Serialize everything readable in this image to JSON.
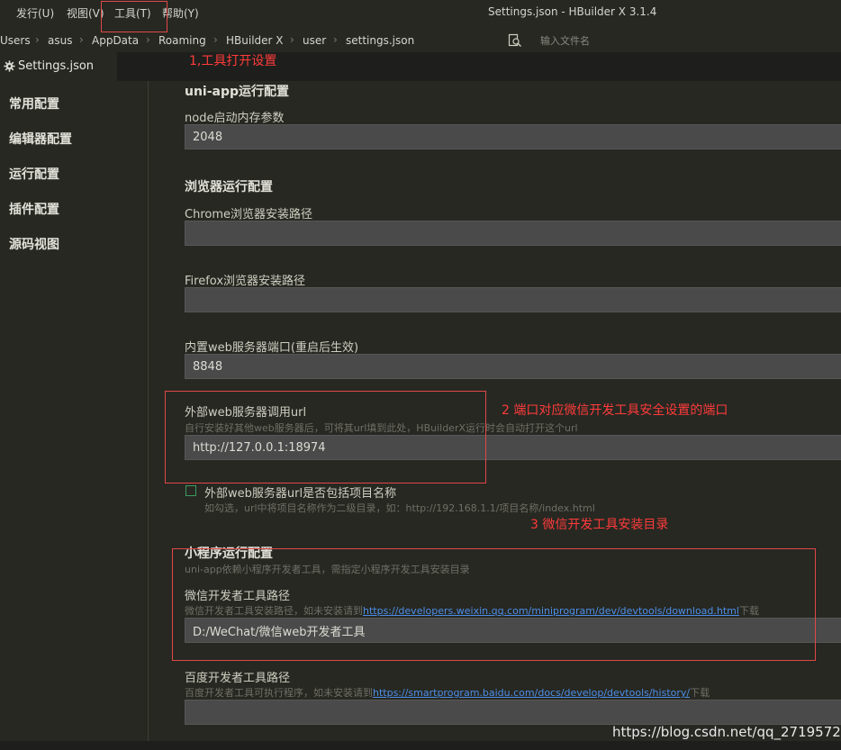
{
  "menu": {
    "items": [
      "发行(U)",
      "视图(V)",
      "工具(T)",
      "帮助(Y)"
    ],
    "window_title": "Settings.json - HBuilder X 3.1.4"
  },
  "breadcrumb": [
    "Users",
    "asus",
    "AppData",
    "Roaming",
    "HBuilder X",
    "user",
    "settings.json"
  ],
  "search": {
    "placeholder": "输入文件名"
  },
  "tab": {
    "label": "Settings.json",
    "icon": "gear-icon"
  },
  "sidebar": {
    "items": [
      {
        "label": "常用配置"
      },
      {
        "label": "编辑器配置"
      },
      {
        "label": "运行配置"
      },
      {
        "label": "插件配置"
      },
      {
        "label": "源码视图"
      }
    ]
  },
  "settings": {
    "uniapp_section": "uni-app运行配置",
    "node_label": "node启动内存参数",
    "node_value": "2048",
    "browser_section": "浏览器运行配置",
    "chrome_label": "Chrome浏览器安装路径",
    "chrome_value": "",
    "firefox_label": "Firefox浏览器安装路径",
    "firefox_value": "",
    "port_label": "内置web服务器端口(重启后生效)",
    "port_value": "8848",
    "ext_url_label": "外部web服务器调用url",
    "ext_url_desc": "自行安装好其他web服务器后，可将其url填到此处，HBuilderX运行时会自动打开这个url",
    "ext_url_value": "http://127.0.0.1:18974",
    "include_name_label": "外部web服务器url是否包括项目名称",
    "include_name_desc": "如勾选，url中将项目名称作为二级目录，如：http://192.168.1.1/项目名称/index.html",
    "mp_section": "小程序运行配置",
    "mp_desc": "uni-app依赖小程序开发者工具，需指定小程序开发工具安装目录",
    "wechat_label": "微信开发者工具路径",
    "wechat_desc_prefix": "微信开发者工具安装路径，如未安装请到",
    "wechat_desc_link": "https://developers.weixin.qq.com/miniprogram/dev/devtools/download.html",
    "wechat_desc_suffix": "下载",
    "wechat_value": "D:/WeChat/微信web开发者工具",
    "baidu_label": "百度开发者工具路径",
    "baidu_desc_prefix": "百度开发者工具可执行程序，如未安装请到",
    "baidu_desc_link": "https://smartprogram.baidu.com/docs/develop/devtools/history/",
    "baidu_desc_suffix": "下载",
    "baidu_value": ""
  },
  "annotations": {
    "note1": "1,工具打开设置",
    "note2": "2 端口对应微信开发工具安全设置的端口",
    "note3": "3 微信开发工具安装目录",
    "color": "#ff3b3b"
  },
  "watermark": "https://blog.csdn.net/qq_27195727",
  "colors": {
    "background": "#272822",
    "input_bg": "#4a4a4a",
    "link": "#4d8ee8",
    "checkbox": "#3c9a5f"
  }
}
